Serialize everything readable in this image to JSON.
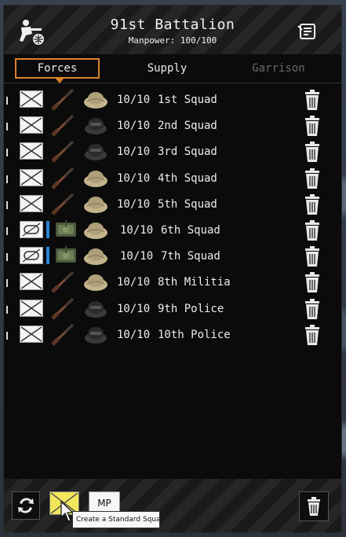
{
  "header": {
    "title": "91st Battalion",
    "subtitle": "Manpower: 100/100",
    "left_icon": "soldier-globe-icon",
    "right_icon": "notes-icon"
  },
  "tabs": [
    {
      "label": "Forces",
      "active": true
    },
    {
      "label": "Supply",
      "active": false
    },
    {
      "label": "Garrison",
      "active": false,
      "disabled": true
    }
  ],
  "squads": [
    {
      "count": "10/10",
      "name": "1st Squad",
      "type": "infantry",
      "vehicle": "tan-helmet-icon"
    },
    {
      "count": "10/10",
      "name": "2nd Squad",
      "type": "infantry",
      "vehicle": "dark-helmet-icon"
    },
    {
      "count": "10/10",
      "name": "3rd Squad",
      "type": "infantry",
      "vehicle": "dark-helmet-icon"
    },
    {
      "count": "10/10",
      "name": "4th Squad",
      "type": "infantry",
      "vehicle": "tan-helmet-icon"
    },
    {
      "count": "10/10",
      "name": "5th Squad",
      "type": "infantry",
      "vehicle": "tan-helmet-icon"
    },
    {
      "count": "10/10",
      "name": "6th Squad",
      "type": "armored",
      "vehicle": "tan-helmet-icon"
    },
    {
      "count": "10/10",
      "name": "7th Squad",
      "type": "armored",
      "vehicle": "tan-helmet-icon"
    },
    {
      "count": "10/10",
      "name": "8th Militia",
      "type": "infantry",
      "vehicle": "tan-helmet-icon"
    },
    {
      "count": "10/10",
      "name": "9th Police",
      "type": "infantry",
      "vehicle": "dark-helmet-icon"
    },
    {
      "count": "10/10",
      "name": "10th Police",
      "type": "infantry",
      "vehicle": "dark-helmet-icon"
    }
  ],
  "toolbar": {
    "mp_label": "MP",
    "tooltip": "Create a Standard Squad"
  },
  "colors": {
    "accent": "#d9832a",
    "create_button": "#f3e65a",
    "armored_bar": "#2a86d6"
  }
}
